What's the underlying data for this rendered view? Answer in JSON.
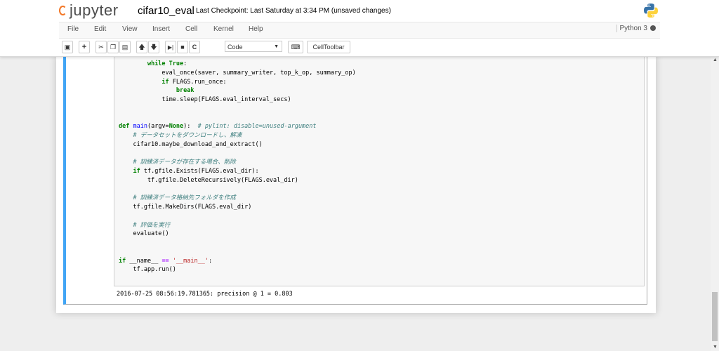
{
  "header": {
    "logo_text": "jupyter",
    "notebook_name": "cifar10_eval",
    "checkpoint": "Last Checkpoint: Last Saturday at 3:34 PM (unsaved changes)"
  },
  "menu": {
    "file": "File",
    "edit": "Edit",
    "view": "View",
    "insert": "Insert",
    "cell": "Cell",
    "kernel": "Kernel",
    "help": "Help"
  },
  "kernel_indicator": "Python 3",
  "toolbar": {
    "cell_type": "Code",
    "celltoolbar": "CellToolbar"
  },
  "code": {
    "l01a": "        ",
    "l01b": "while",
    "l01c": " ",
    "l01d": "True",
    "l01e": ":",
    "l02": "            eval_once(saver, summary_writer, top_k_op, summary_op)",
    "l03a": "            ",
    "l03b": "if",
    "l03c": " FLAGS.run_once:",
    "l04a": "                ",
    "l04b": "break",
    "l05": "            time.sleep(FLAGS.eval_interval_secs)",
    "l08a": "def",
    "l08b": " ",
    "l08c": "main",
    "l08d": "(argv=",
    "l08e": "None",
    "l08f": "):  ",
    "l08g": "# pylint: disable=unused-argument",
    "l09a": "    ",
    "l09b": "# データセットをダウンロードし、解凍",
    "l10": "    cifar10.maybe_download_and_extract()",
    "l12a": "    ",
    "l12b": "# 訓練済データが存在する場合、削除",
    "l13a": "    ",
    "l13b": "if",
    "l13c": " tf.gfile.Exists(FLAGS.eval_dir):",
    "l14": "        tf.gfile.DeleteRecursively(FLAGS.eval_dir)",
    "l16a": "    ",
    "l16b": "# 訓練済データ格納先フォルダを作成",
    "l17": "    tf.gfile.MakeDirs(FLAGS.eval_dir)",
    "l19a": "    ",
    "l19b": "# 評価を実行",
    "l20": "    evaluate()",
    "l23a": "if",
    "l23b": " __name__ ",
    "l23c": "==",
    "l23d": " ",
    "l23e": "'__main__'",
    "l23f": ":",
    "l24": "    tf.app.run()"
  },
  "output": "2016-07-25 08:56:19.781365: precision @ 1 = 0.803",
  "colors": {
    "selected_cell_border": "#42a5f5",
    "jupyter_orange": "#f37726",
    "keyword": "#008000",
    "comment": "#408080",
    "string": "#ba2121"
  }
}
